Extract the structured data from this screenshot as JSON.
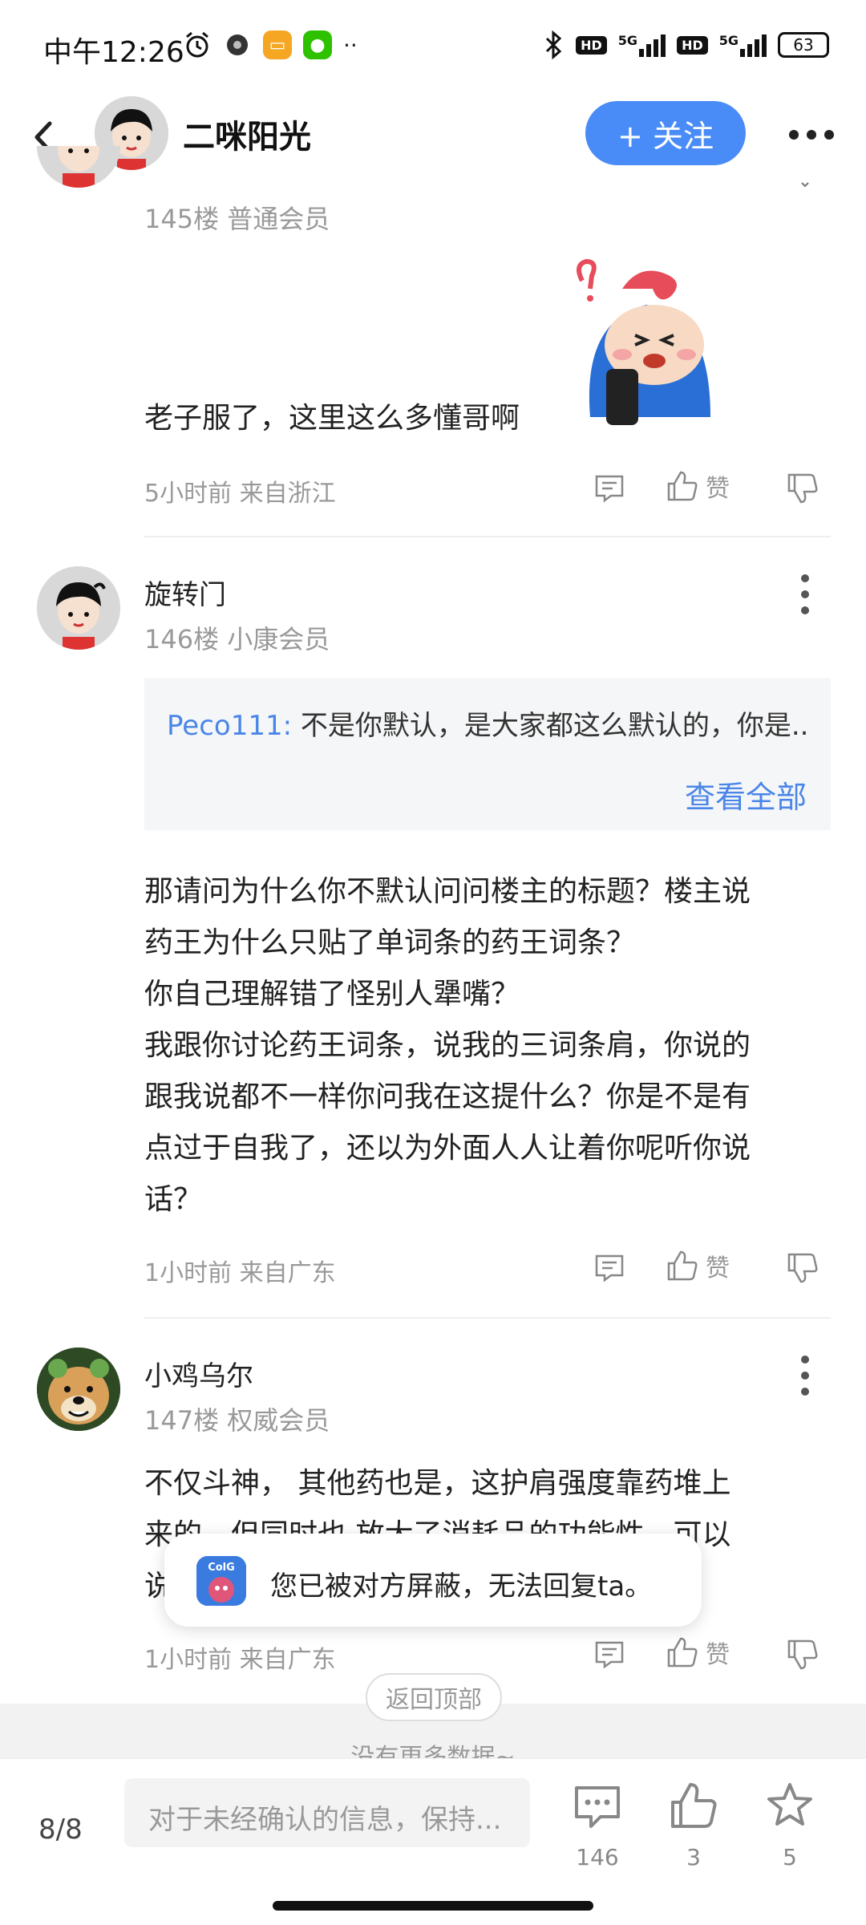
{
  "status": {
    "time": "中午12:26",
    "battery": "63",
    "signal1": "5G",
    "signal2": "5G",
    "hd": "HD"
  },
  "header": {
    "name": "二咪阳光",
    "follow_label": "+ 关注"
  },
  "posts": [
    {
      "floor": "145楼 普通会员",
      "text": "老子服了，这里这么多懂哥啊",
      "meta": "5小时前 来自浙江",
      "like_label": "赞"
    },
    {
      "username": "旋转门",
      "floor": "146楼 小康会员",
      "quote_user": "Peco111:",
      "quote_text": " 不是你默认，是大家都这么默认的，你是...",
      "quote_more": "查看全部",
      "text_lines": [
        "那请问为什么你不默认问问楼主的标题？楼主说",
        "药王为什么只贴了单词条的药王词条？",
        "你自己理解错了怪别人犟嘴？",
        "我跟你讨论药王词条，说我的三词条肩，你说的",
        "跟我说都不一样你问我在这提什么？你是不是有",
        "点过于自我了，还以为外面人人让着你呢听你说",
        "话？"
      ],
      "meta": "1小时前 来自广东",
      "like_label": "赞"
    },
    {
      "username": "小鸡乌尔",
      "floor": "147楼 权威会员",
      "text_lines": [
        "不仅斗神， 其他药也是，这护肩强度靠药堆上",
        "来的，但同时也 放大了消耗品的功能性，可以",
        "说"
      ],
      "meta": "1小时前 来自广东",
      "like_label": "赞"
    }
  ],
  "toast": {
    "text": "您已被对方屏蔽，无法回复ta。",
    "logo": "ColG"
  },
  "back_to_top": "返回顶部",
  "no_more": "没有更多数据~",
  "bottom": {
    "page": "8/8",
    "placeholder": "对于未经确认的信息，保持...",
    "comments": "146",
    "likes": "3",
    "stars": "5"
  }
}
